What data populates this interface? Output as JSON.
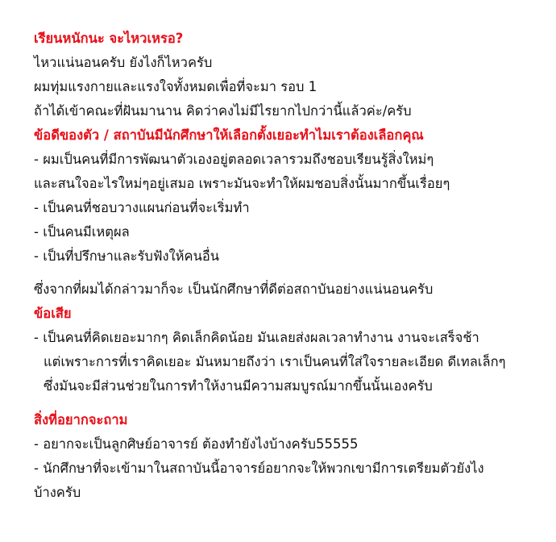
{
  "colors": {
    "heading": "#e8101a",
    "text": "#111111",
    "background": "#ffffff"
  },
  "section1": {
    "heading": "เรียนหนักนะ จะไหวเหรอ?",
    "lines": [
      "ไหวแน่นอนครับ ยังไงก็ไหวครับ",
      "ผมทุ่มแรงกายและแรงใจทั้งหมดเพื่อที่จะมา รอบ 1",
      "ถ้าได้เข้าคณะที่ฝันมานาน คิดว่าคงไม่มีไรยากไปกว่านี้แล้วค่ะ/ครับ"
    ]
  },
  "section2": {
    "heading": "ข้อดีของตัว / สถาบันมีนักศึกษาให้เลือกตั้งเยอะทำไมเราต้องเลือกคุณ",
    "lines": [
      "- ผมเป็นคนที่มีการพัฒนาตัวเองอยู่ตลอดเวลารวมถึงชอบเรียนรู้สิ่งใหม่ๆ",
      "และสนใจอะไรใหม่ๆอยู่เสมอ เพราะมันจะทำให้ผมชอบสิ่งนั้นมากขึ้นเรื่อยๆ",
      "- เป็นคนที่ชอบวางแผนก่อนที่จะเริ่มทำ",
      "- เป็นคนมีเหตุผล",
      "- เป็นที่ปรึกษาและรับฟังให้คนอื่น"
    ],
    "summary": "ซึ่งจากที่ผมได้กล่าวมาก็จะ เป็นนักศึกษาที่ดีต่อสถาบันอย่างแน่นอนครับ"
  },
  "section3": {
    "heading": "ข้อเสีย",
    "lines": [
      "- เป็นคนที่คิดเยอะมากๆ คิดเล็กคิดน้อย มันเลยส่งผลเวลาทำงาน งานจะเสร็จช้า",
      "แต่เพราะการที่เราคิดเยอะ มันหมายถึงว่า เราเป็นคนที่ใส่ใจรายละเอียด ดีเทลเล็กๆ",
      "ซึ่งมันจะมีส่วนช่วยในการทำให้งานมีความสมบูรณ์มากขึ้นนั้นเองครับ"
    ]
  },
  "section4": {
    "heading": "สิ่งที่อยากจะถาม",
    "lines": [
      "- อยากจะเป็นลูกศิษย์อาจารย์ ต้องทำยังไงบ้างครับ55555",
      "- นักศึกษาที่จะเข้ามาในสถาบันนี้อาจารย์อยากจะให้พวกเขามีการเตรียมตัวยังไง",
      "บ้างครับ"
    ]
  }
}
